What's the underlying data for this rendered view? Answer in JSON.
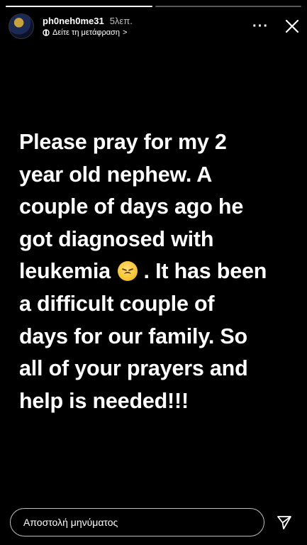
{
  "progress": {
    "segments": [
      {
        "filled_fraction": 1.0
      },
      {
        "filled_fraction": 0.0
      }
    ]
  },
  "header": {
    "username": "ph0neh0me31",
    "time_ago": "5λεπ.",
    "translate_label": "Δείτε τη μετάφραση",
    "translate_chevron": ">",
    "more_label": "···"
  },
  "story": {
    "lines": [
      "Please pray for my 2",
      "year old nephew. A",
      "couple of days ago he",
      "got diagnosed with",
      "leukemia",
      ". It has been",
      "a difficult couple of",
      "days for our family. So",
      "all of your prayers and",
      "help is needed!!!"
    ],
    "emoji": "disappointed-face"
  },
  "footer": {
    "message_placeholder": "Αποστολή μηνύματος"
  },
  "colors": {
    "background": "#000000",
    "text": "#ffffff"
  }
}
